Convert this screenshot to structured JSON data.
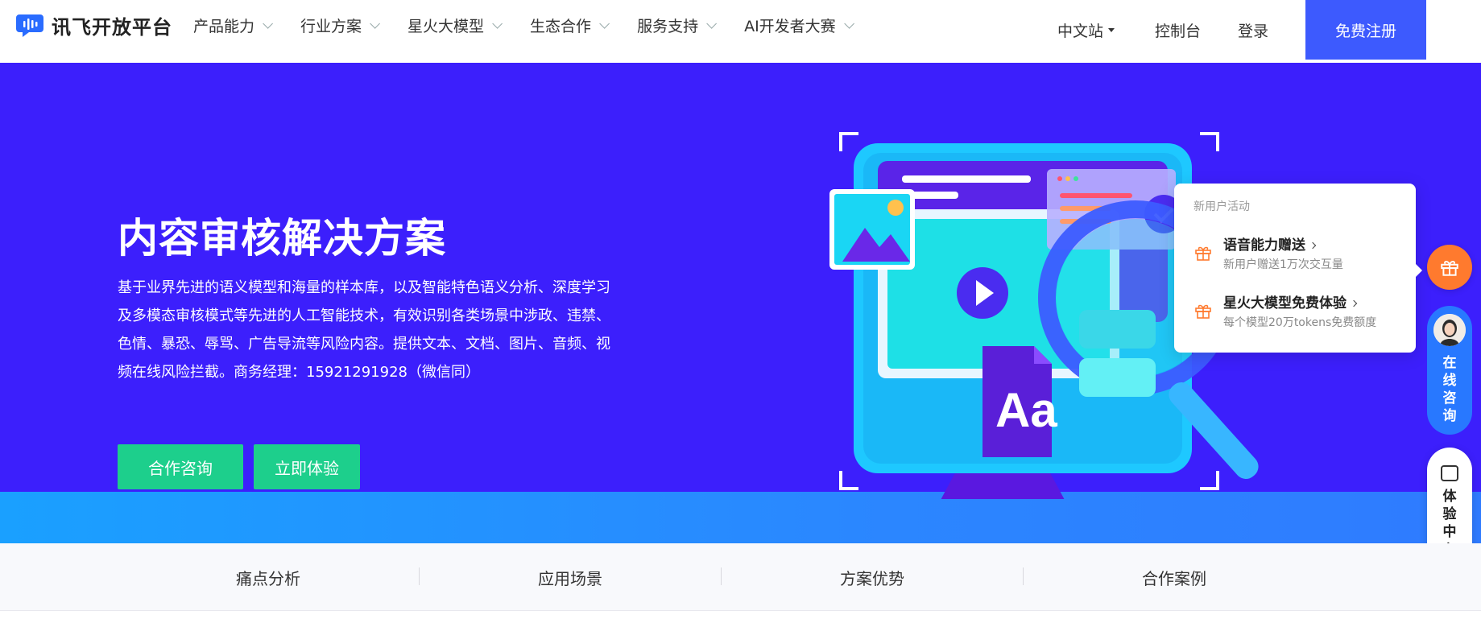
{
  "header": {
    "logo_text": "讯飞开放平台",
    "nav": [
      {
        "label": "产品能力"
      },
      {
        "label": "行业方案"
      },
      {
        "label": "星火大模型"
      },
      {
        "label": "生态合作"
      },
      {
        "label": "服务支持"
      },
      {
        "label": "AI开发者大赛"
      }
    ],
    "lang": "中文站",
    "console": "控制台",
    "login": "登录",
    "register": "免费注册"
  },
  "hero": {
    "title": "内容审核解决方案",
    "description": "基于业界先进的语义模型和海量的样本库，以及智能特色语义分析、深度学习及多模态审核模式等先进的人工智能技术，有效识别各类场景中涉政、违禁、色情、暴恐、辱骂、广告导流等风险内容。提供文本、文档、图片、音频、视频在线风险拦截。商务经理：15921291928（微信同）",
    "btn_consult": "合作咨询",
    "btn_try": "立即体验",
    "illustration_letters": "Aa"
  },
  "promo": {
    "heading": "新用户活动",
    "items": [
      {
        "title": "语音能力赠送",
        "subtitle": "新用户赠送1万次交互量"
      },
      {
        "title": "星火大模型免费体验",
        "subtitle": "每个模型20万tokens免费额度"
      }
    ]
  },
  "float": {
    "consult": "在线咨询",
    "experience": "体验中心"
  },
  "tabs": [
    {
      "label": "痛点分析"
    },
    {
      "label": "应用场景"
    },
    {
      "label": "方案优势"
    },
    {
      "label": "合作案例"
    }
  ],
  "colors": {
    "hero_bg": "#3c1ffc",
    "accent_blue": "#3d5afe",
    "button_green": "#1dcf8c",
    "gift_orange": "#ff7a2e",
    "consult_blue": "#2878ff"
  }
}
